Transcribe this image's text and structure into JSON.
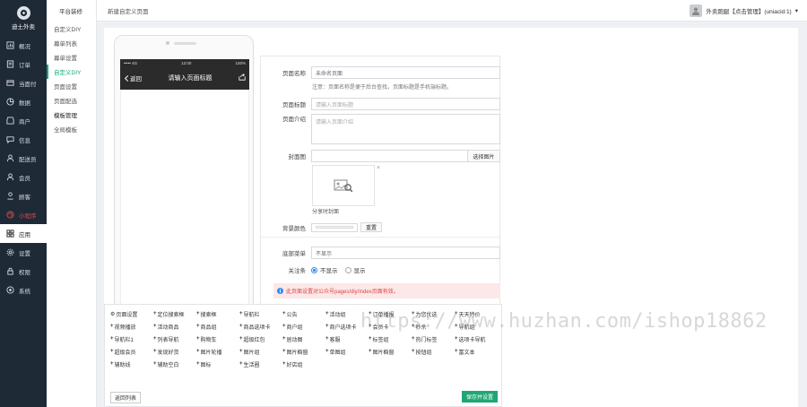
{
  "brand": {
    "name": "迪士外卖"
  },
  "nav": [
    {
      "label": "概况",
      "icon": "chart-icon",
      "state": ""
    },
    {
      "label": "订单",
      "icon": "order-icon",
      "state": ""
    },
    {
      "label": "当面付",
      "icon": "pay-icon",
      "state": ""
    },
    {
      "label": "数据",
      "icon": "data-icon",
      "state": ""
    },
    {
      "label": "商户",
      "icon": "store-icon",
      "state": ""
    },
    {
      "label": "信息",
      "icon": "message-icon",
      "state": ""
    },
    {
      "label": "配送员",
      "icon": "rider-icon",
      "state": ""
    },
    {
      "label": "会员",
      "icon": "member-icon",
      "state": ""
    },
    {
      "label": "顾客",
      "icon": "customer-icon",
      "state": ""
    },
    {
      "label": "小程序",
      "icon": "miniapp-icon",
      "state": "hot"
    },
    {
      "label": "应用",
      "icon": "apps-icon",
      "state": "active"
    },
    {
      "label": "设置",
      "icon": "settings-icon",
      "state": ""
    },
    {
      "label": "权限",
      "icon": "permission-icon",
      "state": ""
    },
    {
      "label": "系统",
      "icon": "system-icon",
      "state": ""
    }
  ],
  "submenu": {
    "title": "平台装修",
    "items": [
      {
        "label": "自定义DIY",
        "state": ""
      },
      {
        "label": "幕单列表",
        "state": ""
      },
      {
        "label": "幕单设置",
        "state": ""
      },
      {
        "label": "自定义DIY",
        "state": "active"
      },
      {
        "label": "页面设置",
        "state": ""
      },
      {
        "label": "页面配选",
        "state": ""
      },
      {
        "label": "模板管理",
        "state": "group"
      },
      {
        "label": "全局模板",
        "state": ""
      }
    ]
  },
  "header": {
    "breadcrumb": "新建自定义页面",
    "user": "外卖跑腿【点击管理】(uniacid:1)"
  },
  "phone": {
    "status_left": "••••• 4G",
    "status_time": "12:00",
    "status_right": "100%",
    "back_label": "返回",
    "title": "请输入页面标题"
  },
  "form": {
    "name_label": "页面名称",
    "name_value": "未命名页面",
    "name_hint": "注意：页面名称是便于后台查找，页面标题是手机端标题。",
    "title_label": "页面标题",
    "title_placeholder": "请输入页面标题",
    "desc_label": "页面介绍",
    "desc_placeholder": "请输入页面介绍",
    "cover_label": "封面图",
    "cover_button": "选择图片",
    "cover_caption": "分享时封面",
    "bg_label": "背景颜色",
    "reset_button": "重置",
    "menu_label": "底部菜单",
    "menu_value": "不显示",
    "follow_label": "关注条",
    "follow_options": [
      "不显示",
      "显示"
    ],
    "alert": "此页面设置对公众号pages/diy/index页面有效。"
  },
  "components": [
    "页面设置",
    "定位搜索框",
    "搜索框",
    "导航栏",
    "公告",
    "活动组",
    "订单播报",
    "为您优选",
    "天天特价",
    "视频播放",
    "活动商品",
    "商品组",
    "商品选项卡",
    "商户组",
    "商户选项卡",
    "会员卡",
    "秒杀",
    "导航组",
    "导航栏1",
    "列表导航",
    "购物车",
    "超级红包",
    "居动图",
    "客服",
    "标签组",
    "热门标签",
    "选项卡导航",
    "超级会员",
    "发现好货",
    "图片轮播",
    "图片组",
    "图片橱窗",
    "单图组",
    "图片橱窗",
    "按钮组",
    "富文本",
    "辅助线",
    "辅助空白",
    "图标",
    "生活圈",
    "好店组"
  ],
  "footer": {
    "back": "返回列表",
    "save": "保存并设置"
  },
  "watermark": "https://www.huzhan.com/ishop18862",
  "colors": {
    "sidebar": "#1f2a37",
    "accent": "#17a67a",
    "hot": "#e04b4b",
    "save": "#1fa672"
  }
}
